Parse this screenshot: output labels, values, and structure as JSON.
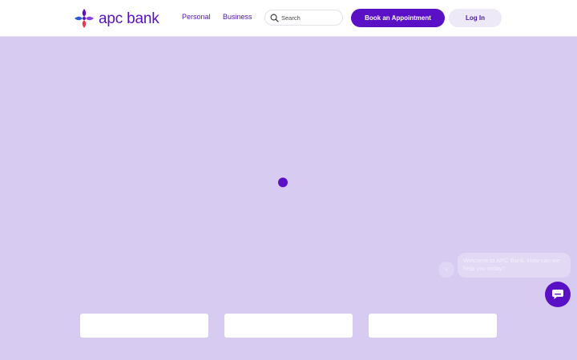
{
  "header": {
    "logo_text": "apc bank",
    "nav": [
      {
        "label": "Personal"
      },
      {
        "label": "Business"
      }
    ],
    "search": {
      "placeholder": "Search",
      "value": ""
    },
    "book_button_label": "Book an Appointment",
    "login_button_label": "Log In"
  },
  "chat": {
    "close_icon": "×",
    "message": "Welcome to APC Bank. How can we help you today?"
  },
  "colors": {
    "brand_purple": "#5a10c4",
    "hero_background": "#d8cbf2",
    "logo_red": "#e8384f",
    "logo_blue": "#2a5bd7"
  },
  "icons": [
    "logo-mark-icon",
    "search-icon",
    "close-icon",
    "chat-icon"
  ]
}
